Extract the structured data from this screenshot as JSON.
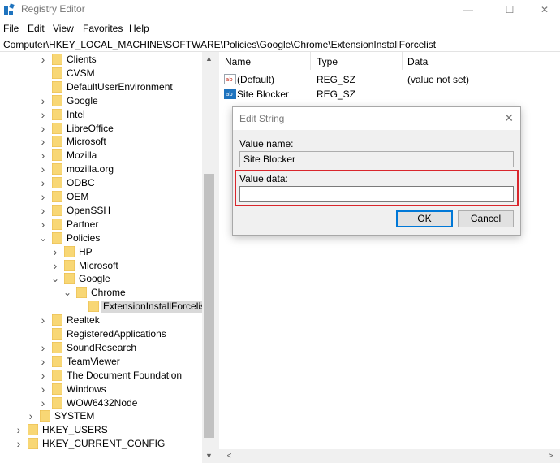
{
  "window": {
    "title": "Registry Editor",
    "minimize": "—",
    "maximize": "☐",
    "close": "✕"
  },
  "menu": [
    "File",
    "Edit",
    "View",
    "Favorites",
    "Help"
  ],
  "address": "Computer\\HKEY_LOCAL_MACHINE\\SOFTWARE\\Policies\\Google\\Chrome\\ExtensionInstallForcelist",
  "tree": [
    {
      "label": "Clients",
      "level": 3,
      "chevron": "right"
    },
    {
      "label": "CVSM",
      "level": 3,
      "chevron": "none"
    },
    {
      "label": "DefaultUserEnvironment",
      "level": 3,
      "chevron": "none"
    },
    {
      "label": "Google",
      "level": 3,
      "chevron": "right"
    },
    {
      "label": "Intel",
      "level": 3,
      "chevron": "right"
    },
    {
      "label": "LibreOffice",
      "level": 3,
      "chevron": "right"
    },
    {
      "label": "Microsoft",
      "level": 3,
      "chevron": "right"
    },
    {
      "label": "Mozilla",
      "level": 3,
      "chevron": "right"
    },
    {
      "label": "mozilla.org",
      "level": 3,
      "chevron": "right"
    },
    {
      "label": "ODBC",
      "level": 3,
      "chevron": "right"
    },
    {
      "label": "OEM",
      "level": 3,
      "chevron": "right"
    },
    {
      "label": "OpenSSH",
      "level": 3,
      "chevron": "right"
    },
    {
      "label": "Partner",
      "level": 3,
      "chevron": "right"
    },
    {
      "label": "Policies",
      "level": 3,
      "chevron": "down"
    },
    {
      "label": "HP",
      "level": 4,
      "chevron": "right"
    },
    {
      "label": "Microsoft",
      "level": 4,
      "chevron": "right"
    },
    {
      "label": "Google",
      "level": 4,
      "chevron": "down"
    },
    {
      "label": "Chrome",
      "level": 5,
      "chevron": "down"
    },
    {
      "label": "ExtensionInstallForcelist",
      "level": 6,
      "chevron": "none",
      "selected": true
    },
    {
      "label": "Realtek",
      "level": 3,
      "chevron": "right"
    },
    {
      "label": "RegisteredApplications",
      "level": 3,
      "chevron": "none"
    },
    {
      "label": "SoundResearch",
      "level": 3,
      "chevron": "right"
    },
    {
      "label": "TeamViewer",
      "level": 3,
      "chevron": "right"
    },
    {
      "label": "The Document Foundation",
      "level": 3,
      "chevron": "right"
    },
    {
      "label": "Windows",
      "level": 3,
      "chevron": "right"
    },
    {
      "label": "WOW6432Node",
      "level": 3,
      "chevron": "right"
    },
    {
      "label": "SYSTEM",
      "level": 2,
      "chevron": "right"
    },
    {
      "label": "HKEY_USERS",
      "level": 1,
      "chevron": "right"
    },
    {
      "label": "HKEY_CURRENT_CONFIG",
      "level": 1,
      "chevron": "right"
    }
  ],
  "list": {
    "headers": {
      "name": "Name",
      "type": "Type",
      "data": "Data"
    },
    "rows": [
      {
        "name": "(Default)",
        "type": "REG_SZ",
        "data": "(value not set)"
      },
      {
        "name": "Site Blocker",
        "type": "REG_SZ",
        "data": ""
      }
    ]
  },
  "dialog": {
    "title": "Edit String",
    "close": "✕",
    "value_name_label": "Value name:",
    "value_name": "Site Blocker",
    "value_data_label": "Value data:",
    "value_data": "",
    "ok": "OK",
    "cancel": "Cancel",
    "highlight_color": "#d9262c"
  },
  "colors": {
    "folder": "#f8d775",
    "folder_dark": "#e3b341",
    "selection": "#d9d9d9",
    "accent": "#0078d7"
  }
}
